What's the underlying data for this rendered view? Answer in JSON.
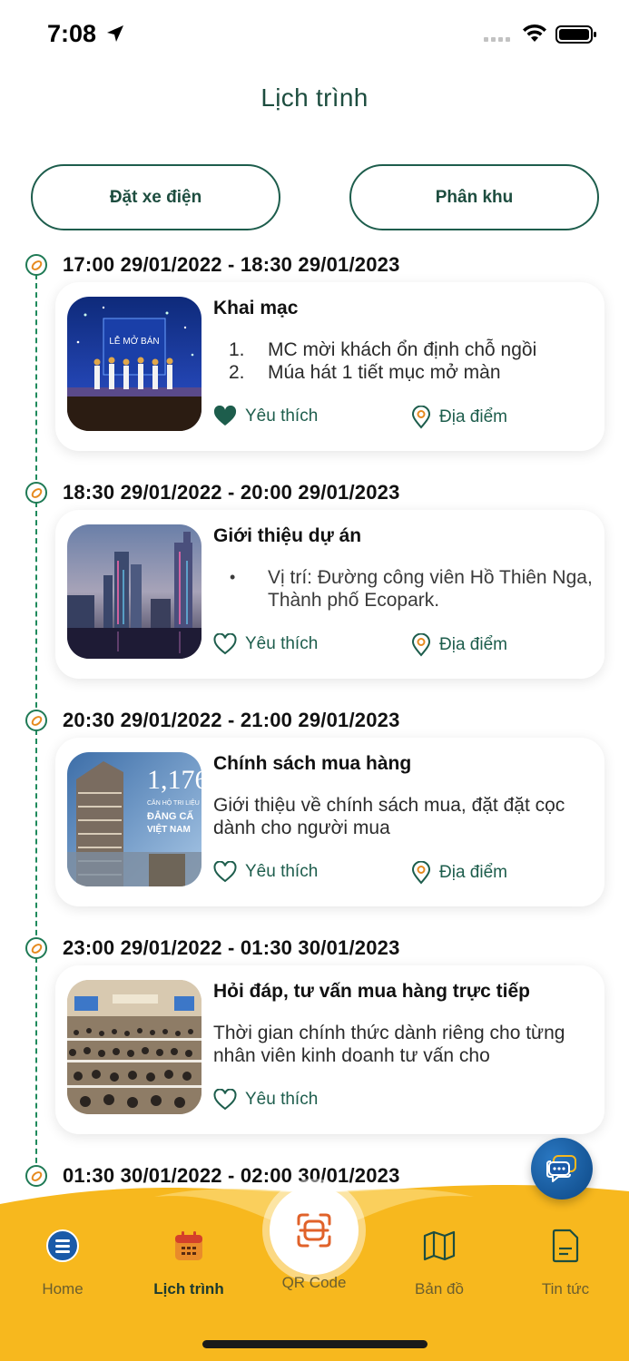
{
  "status_bar": {
    "time": "7:08"
  },
  "header": {
    "title": "Lịch trình"
  },
  "actions": {
    "ecar_label": "Đặt xe điện",
    "zone_label": "Phân khu"
  },
  "schedule": [
    {
      "time": "17:00 29/01/2022 - 18:30 29/01/2023",
      "title": "Khai mạc",
      "list_style": "numbered",
      "items": [
        "MC mời khách ổn định chỗ ngồi",
        "Múa hát 1 tiết mục mở màn"
      ],
      "like_label": "Yêu thích",
      "liked": true,
      "place_label": "Địa điểm"
    },
    {
      "time": "18:30 29/01/2022 - 20:00 29/01/2023",
      "title": "Giới thiệu dự án",
      "list_style": "bullet",
      "items": [
        "Vị trí: Đường công viên Hồ Thiên Nga, Thành phố Ecopark."
      ],
      "like_label": "Yêu thích",
      "liked": false,
      "place_label": "Địa điểm"
    },
    {
      "time": "20:30 29/01/2022 - 21:00 29/01/2023",
      "title": "Chính sách mua hàng",
      "list_style": "plain",
      "description": "Giới thiệu về chính sách mua, đặt đặt cọc dành cho người mua",
      "thumb_text": {
        "number": "1,176",
        "line1": "CĂN HỘ TRI LIỆU",
        "line2": "ĐẲNG CẤ",
        "line3": "VIỆT NAM"
      },
      "like_label": "Yêu thích",
      "liked": false,
      "place_label": "Địa điểm"
    },
    {
      "time": "23:00 29/01/2022 - 01:30 30/01/2023",
      "title": "Hỏi đáp, tư vấn mua hàng trực tiếp",
      "list_style": "plain",
      "description": "Thời gian chính thức dành riêng cho từng nhân viên kinh doanh tư vấn cho",
      "like_label": "Yêu thích",
      "liked": false
    },
    {
      "time": "01:30 30/01/2022 - 02:00 30/01/2023"
    }
  ],
  "thumb1_text": {
    "headline": "LỄ MỞ BÁN"
  },
  "bottom_nav": {
    "items": [
      {
        "label": "Home",
        "icon": "home-icon"
      },
      {
        "label": "Lịch trình",
        "icon": "calendar-icon",
        "active": true
      },
      {
        "label": "Bản đồ",
        "icon": "map-icon"
      },
      {
        "label": "Tin tức",
        "icon": "news-icon"
      }
    ],
    "qr_label": "QR Code"
  },
  "colors": {
    "primary": "#1d5d4c",
    "accent_yellow": "#f7b81e",
    "timeline_orange": "#e68a1f",
    "chat_blue": "#0d4784"
  }
}
